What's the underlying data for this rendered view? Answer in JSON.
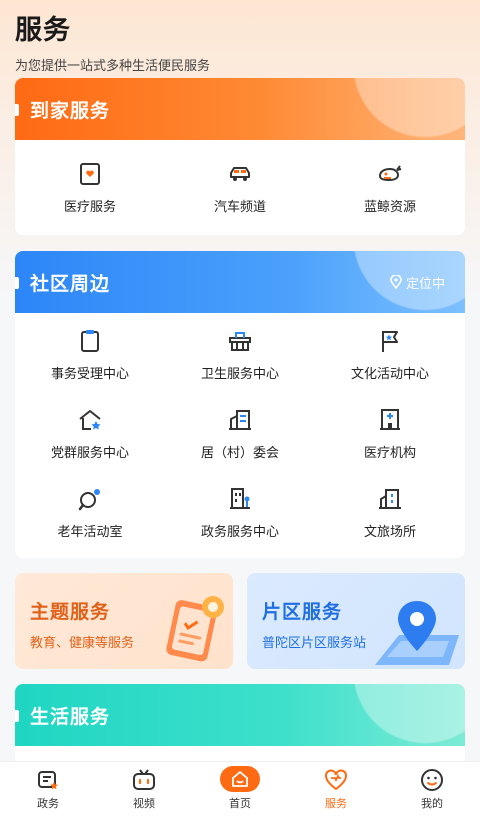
{
  "page": {
    "title": "服务",
    "subtitle": "为您提供一站式多种生活便民服务"
  },
  "home_service": {
    "title": "到家服务",
    "items": [
      {
        "label": "医疗服务",
        "icon": "medical-box-icon"
      },
      {
        "label": "汽车频道",
        "icon": "car-icon"
      },
      {
        "label": "蓝鲸资源",
        "icon": "whale-icon"
      }
    ]
  },
  "community": {
    "title": "社区周边",
    "location_label": "定位中",
    "items": [
      {
        "label": "事务受理中心",
        "icon": "clipboard-icon"
      },
      {
        "label": "卫生服务中心",
        "icon": "sanitation-icon"
      },
      {
        "label": "文化活动中心",
        "icon": "flag-icon"
      },
      {
        "label": "党群服务中心",
        "icon": "house-star-icon"
      },
      {
        "label": "居（村）委会",
        "icon": "building-icon"
      },
      {
        "label": "医疗机构",
        "icon": "hospital-icon"
      },
      {
        "label": "老年活动室",
        "icon": "pingpong-icon"
      },
      {
        "label": "政务服务中心",
        "icon": "gov-building-icon"
      },
      {
        "label": "文旅场所",
        "icon": "culture-building-icon"
      }
    ]
  },
  "promos": {
    "theme": {
      "title": "主题服务",
      "subtitle": "教育、健康等服务"
    },
    "area": {
      "title": "片区服务",
      "subtitle": "普陀区片区服务站"
    }
  },
  "life_service": {
    "title": "生活服务"
  },
  "tabbar": {
    "items": [
      {
        "label": "政务",
        "icon": "government-icon"
      },
      {
        "label": "视频",
        "icon": "tv-icon"
      },
      {
        "label": "首页",
        "icon": "home-icon"
      },
      {
        "label": "服务",
        "icon": "heart-icon",
        "active": true
      },
      {
        "label": "我的",
        "icon": "smile-icon"
      }
    ]
  },
  "colors": {
    "orange": "#ff6a13",
    "blue": "#2d86f8",
    "teal": "#1fd6c3"
  }
}
